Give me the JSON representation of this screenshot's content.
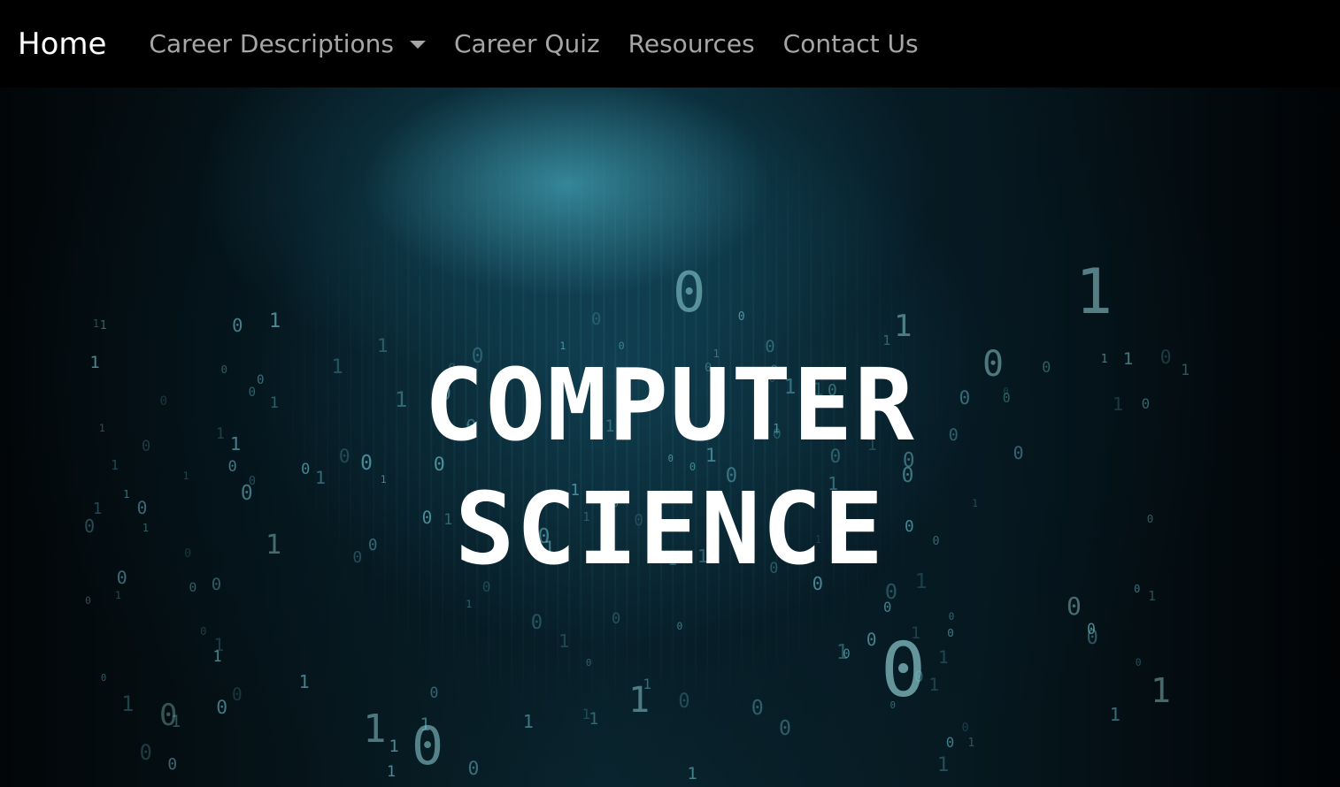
{
  "navbar": {
    "brand": "Home",
    "links": [
      {
        "label": "Career Descriptions",
        "dropdown": true
      },
      {
        "label": "Career Quiz"
      },
      {
        "label": "Resources"
      },
      {
        "label": "Contact Us"
      }
    ]
  },
  "hero": {
    "title_line1": "COMPUTER",
    "title_line2": "SCIENCE",
    "background_theme": "binary-code-rain",
    "background_glyphs": [
      "0",
      "1"
    ]
  },
  "colors": {
    "navbar_bg": "#000000",
    "brand_text": "#ffffff",
    "nav_link_text": "#a6a6a6",
    "hero_title_text": "#ffffff",
    "hero_accent": "#3c96aa"
  }
}
